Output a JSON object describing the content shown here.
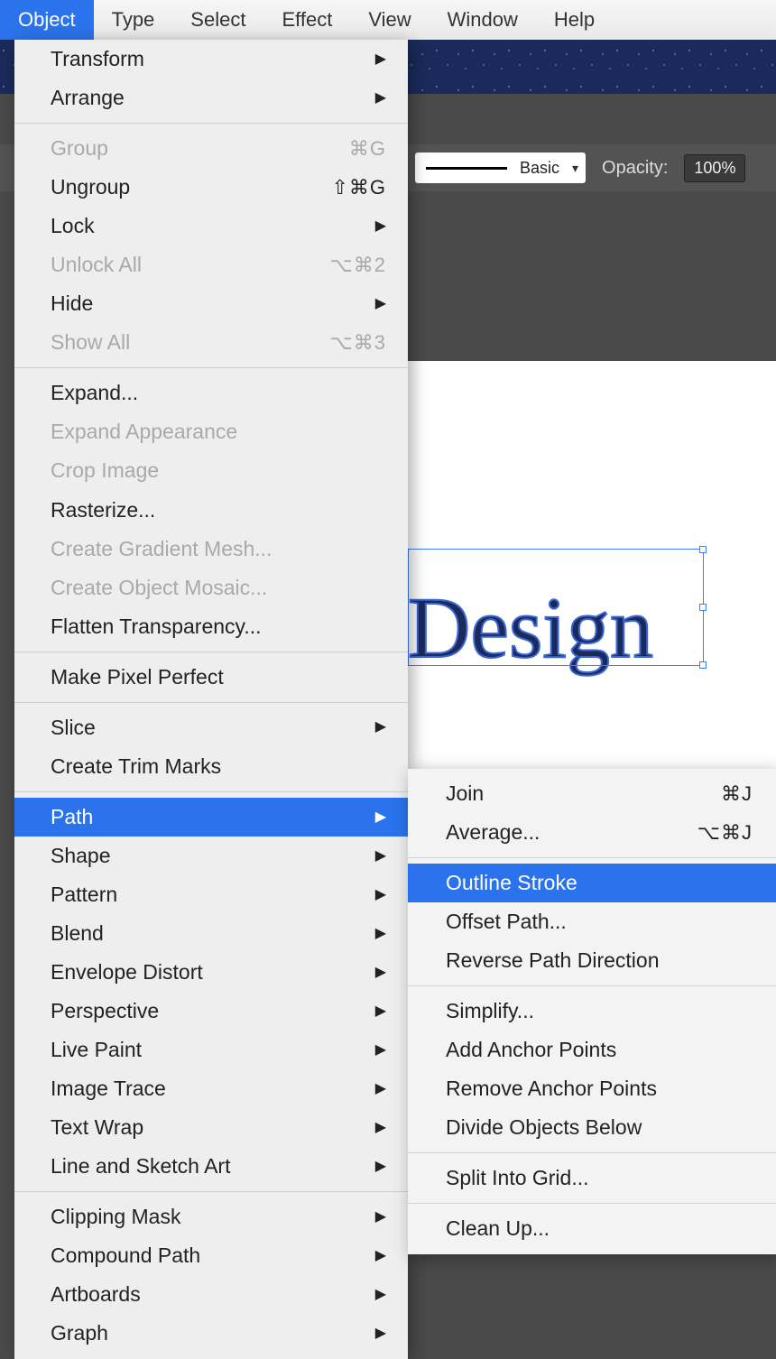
{
  "menubar": {
    "items": [
      "Object",
      "Type",
      "Select",
      "Effect",
      "View",
      "Window",
      "Help"
    ],
    "active_index": 0
  },
  "toolbar": {
    "stroke_style": "Basic",
    "opacity_label": "Opacity:",
    "opacity_value": "100%"
  },
  "canvas": {
    "text_fragment": "Design"
  },
  "object_menu": {
    "groups": [
      [
        {
          "label": "Transform",
          "submenu": true
        },
        {
          "label": "Arrange",
          "submenu": true
        }
      ],
      [
        {
          "label": "Group",
          "shortcut": "⌘G",
          "disabled": true
        },
        {
          "label": "Ungroup",
          "shortcut": "⇧⌘G"
        },
        {
          "label": "Lock",
          "submenu": true
        },
        {
          "label": "Unlock All",
          "shortcut": "⌥⌘2",
          "disabled": true
        },
        {
          "label": "Hide",
          "submenu": true
        },
        {
          "label": "Show All",
          "shortcut": "⌥⌘3",
          "disabled": true
        }
      ],
      [
        {
          "label": "Expand..."
        },
        {
          "label": "Expand Appearance",
          "disabled": true
        },
        {
          "label": "Crop Image",
          "disabled": true
        },
        {
          "label": "Rasterize..."
        },
        {
          "label": "Create Gradient Mesh...",
          "disabled": true
        },
        {
          "label": "Create Object Mosaic...",
          "disabled": true
        },
        {
          "label": "Flatten Transparency..."
        }
      ],
      [
        {
          "label": "Make Pixel Perfect"
        }
      ],
      [
        {
          "label": "Slice",
          "submenu": true
        },
        {
          "label": "Create Trim Marks"
        }
      ],
      [
        {
          "label": "Path",
          "submenu": true,
          "highlight": true
        },
        {
          "label": "Shape",
          "submenu": true
        },
        {
          "label": "Pattern",
          "submenu": true
        },
        {
          "label": "Blend",
          "submenu": true
        },
        {
          "label": "Envelope Distort",
          "submenu": true
        },
        {
          "label": "Perspective",
          "submenu": true
        },
        {
          "label": "Live Paint",
          "submenu": true
        },
        {
          "label": "Image Trace",
          "submenu": true
        },
        {
          "label": "Text Wrap",
          "submenu": true
        },
        {
          "label": "Line and Sketch Art",
          "submenu": true
        }
      ],
      [
        {
          "label": "Clipping Mask",
          "submenu": true
        },
        {
          "label": "Compound Path",
          "submenu": true
        },
        {
          "label": "Artboards",
          "submenu": true
        },
        {
          "label": "Graph",
          "submenu": true
        }
      ]
    ]
  },
  "path_submenu": {
    "groups": [
      [
        {
          "label": "Join",
          "shortcut": "⌘J"
        },
        {
          "label": "Average...",
          "shortcut": "⌥⌘J"
        }
      ],
      [
        {
          "label": "Outline Stroke",
          "highlight": true
        },
        {
          "label": "Offset Path..."
        },
        {
          "label": "Reverse Path Direction"
        }
      ],
      [
        {
          "label": "Simplify..."
        },
        {
          "label": "Add Anchor Points"
        },
        {
          "label": "Remove Anchor Points"
        },
        {
          "label": "Divide Objects Below"
        }
      ],
      [
        {
          "label": "Split Into Grid..."
        }
      ],
      [
        {
          "label": "Clean Up..."
        }
      ]
    ]
  }
}
